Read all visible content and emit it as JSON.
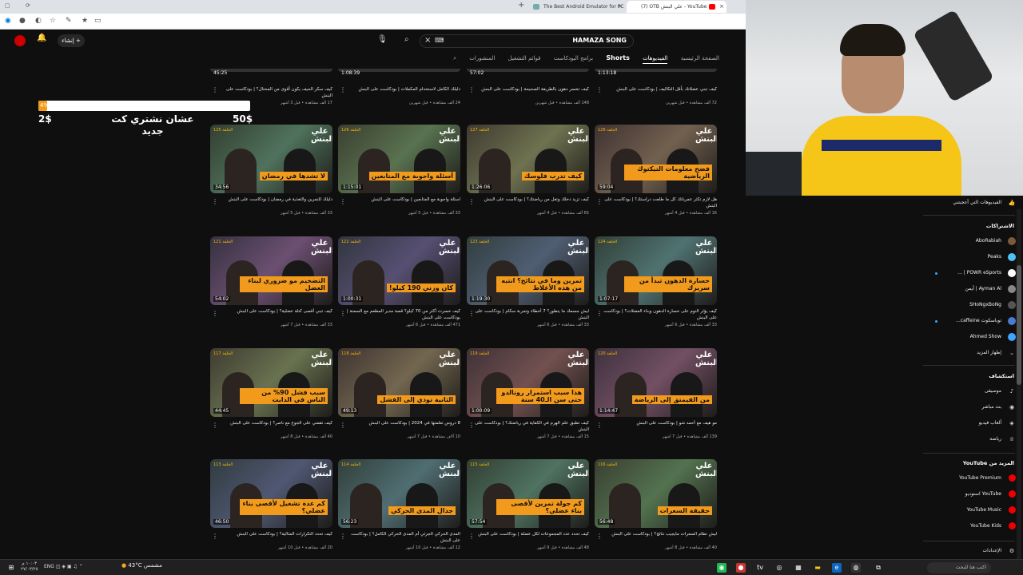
{
  "browser": {
    "tabs": [
      {
        "label": "The Best Android Emulator for PC",
        "active": false
      },
      {
        "label": "(7) OTB علي البنش - YouTube",
        "active": true
      }
    ]
  },
  "youtube": {
    "search_query": "HAMAZA SONG",
    "create_label": "إنشاء",
    "chips": [
      {
        "label": "الصفحة الرئيسية",
        "selected": false
      },
      {
        "label": "الفيديوهات",
        "selected": true
      },
      {
        "label": "Shorts",
        "selected": false
      },
      {
        "label": "برامج البودكاست",
        "selected": false
      },
      {
        "label": "قوائم التشغيل",
        "selected": false
      },
      {
        "label": "المنشورات",
        "selected": false
      }
    ],
    "top_row": [
      {
        "duration": "1:13:18",
        "title": "كيف تبني عضلاتك بأقل التكاليف | بودكاست على البنش",
        "sub": "72 ألف مشاهدة • قبل شهرين"
      },
      {
        "duration": "57:02",
        "title": "كيف تخسر دهون بالطريقة الصحيحة | بودكاست على البنش",
        "sub": "148 ألف مشاهدة • قبل شهرين"
      },
      {
        "duration": "1:08:39",
        "title": "دليلك الكامل لاستخدام المكملات | بودكاست على البنش",
        "sub": "24 ألف مشاهدة • قبل شهرين"
      },
      {
        "duration": "45:25",
        "title": "كيف سكر الحيف يكون أقوى من المحتال؟ | بودكاست على البنش",
        "sub": "17 ألف مشاهدة • قبل 3 أشهر"
      }
    ],
    "videos": [
      {
        "ep": "الحلقة 128",
        "overlay": "فضح معلومات التيكتوك الرياضية",
        "duration": "59:04",
        "title": "هل لازم تكثر عمرياتك كل ما طلعت دراستك؟ | بودكاست على البنش",
        "sub": "16 ألف مشاهدة • قبل 4 أشهر"
      },
      {
        "ep": "الحلقة 127",
        "overlay": "كيف تدرب فلوسك",
        "duration": "1:26:06",
        "title": "كيف تزيد دخلك وتغل من رياضتك؟ | بودكاست على البنش",
        "sub": "65 ألف مشاهدة • قبل 4 أشهر"
      },
      {
        "ep": "الحلقة 126",
        "overlay": "أسئلة واجوبة مع المتابعين",
        "duration": "1:15:01",
        "title": "اسئلة واجوبة مع المتابعين | بودكاست على البنش",
        "sub": "33 ألف مشاهدة • قبل 5 أشهر"
      },
      {
        "ep": "الحلقة 125",
        "overlay": "لا تشدها في رمضان",
        "duration": "34:56",
        "title": "دليلك للتمرين والتغذية في رمضان | بودكاست على البنش",
        "sub": "33 ألف مشاهدة • قبل 5 أشهر"
      },
      {
        "ep": "الحلقة 124",
        "overlay": "خسارة الدهون تبدأ من سريرك",
        "duration": "1:07:17",
        "title": "كيف يؤثر النوم على خسارة الدهون وبناء العضلات؟ | بودكاست على البنش",
        "sub": "33 ألف مشاهدة • قبل 6 أشهر"
      },
      {
        "ep": "الحلقة 123",
        "overlay": "تمرين وما في نتائج؟ انتبه من هذه الأغلاط",
        "duration": "1:19:30",
        "title": "ليش جسمك ما يتطور؟ 7 أخطاء وتجربة سكام | بودكاست على البنش",
        "sub": "33 ألف مشاهدة • قبل 6 أشهر"
      },
      {
        "ep": "الحلقة 122",
        "overlay": "كان وزني 190 كيلو!",
        "duration": "1:00:31",
        "title": "كيف خسرت أكثر من 70 كيلو؟ قصة مدير المطعم مع السمنة | بودكاست على البنش",
        "sub": "471 ألف مشاهدة • قبل 6 أشهر"
      },
      {
        "ep": "الحلقة 121",
        "overlay": "التضخيم مو ضروري لبناء العضل",
        "duration": "54:02",
        "title": "كيف تبني أقصى كتلة عضلية؟ | بودكاست على البنش",
        "sub": "33 ألف مشاهدة • قبل 7 أشهر"
      },
      {
        "ep": "الحلقة 120",
        "overlay": "من الفيمتق إلى الرياضة",
        "duration": "1:14:47",
        "title": "مو هيف مع أحمد شو | بودكاست على البنش",
        "sub": "139 ألف مشاهدة • قبل 7 أشهر"
      },
      {
        "ep": "الحلقة 119",
        "overlay": "هذا سبب استمرار رونالدو حتى سن الـ40 سنة",
        "duration": "1:00:09",
        "title": "كيف تطبق علم الهرم في الكفاية في رياضتك؟ | بودكاست على البنش",
        "sub": "15 ألف مشاهدة • قبل 7 أشهر"
      },
      {
        "ep": "الحلقة 118",
        "overlay": "الثانية تودي إلى الفشل",
        "duration": "49:13",
        "title": "8 دروس تعلمتها في 2024 | بودكاست على البنش",
        "sub": "10 آلاف مشاهدة • قبل 7 أشهر"
      },
      {
        "ep": "الحلقة 117",
        "overlay": "سبب فشل 90% من الناس في الدايت",
        "duration": "44:45",
        "title": "كيف تقضي على الجوع مع ناصر؟ | بودكاست على البنش",
        "sub": "40 ألف مشاهدة • قبل 8 أشهر"
      },
      {
        "ep": "الحلقة 116",
        "overlay": "حقيقة السعرات",
        "duration": "56:48",
        "title": "ليش نظام السعرات مايجيب نتائج؟ | بودكاست على البنش",
        "sub": "40 ألف مشاهدة • قبل 8 أشهر"
      },
      {
        "ep": "الحلقة 115",
        "overlay": "كم جولة تمرين لأقصى بناء عضلي؟",
        "duration": "57:54",
        "title": "كيف تحدد عدد المجموعات لكل عضلة | بودكاست على البنش",
        "sub": "48 ألف مشاهدة • قبل 9 أشهر"
      },
      {
        "ep": "الحلقة 114",
        "overlay": "جدال المدى الحركي",
        "duration": "56:23",
        "title": "المدى الحركي الجزئي أم المدى الحركي الكامل؟ | بودكاست على البنش",
        "sub": "12 ألف مشاهدة • قبل 10 أشهر"
      },
      {
        "ep": "الحلقة 113",
        "overlay": "كم عدة تشغيل لأقصى بناء عضلي؟",
        "duration": "46:50",
        "title": "كيف تحدد التكرارات المثالية؟ | بودكاست على البنش",
        "sub": "20 ألف مشاهدة • قبل 10 أشهر"
      }
    ],
    "brand_text": "علي البنش"
  },
  "donation_overlay": {
    "progress_label": "4%",
    "progress_fraction": 0.04,
    "min_amount": "2$",
    "goal_amount": "50$",
    "goal_text": "عشان نشتري كت جديد"
  },
  "sidebar": {
    "liked": "الفيديوهات التي أعجبتني",
    "subs_heading": "الاشتراكات",
    "subscriptions": [
      {
        "name": "AboRabiah",
        "dot": false,
        "color": "#7a5a3a"
      },
      {
        "name": "Peaks",
        "dot": false,
        "color": "#4fc3f7"
      },
      {
        "name": "POWR eSports | ...",
        "dot": true,
        "color": "#ffffff"
      },
      {
        "name": "Ayman Al | أيمن",
        "dot": false,
        "color": "#888888"
      },
      {
        "name": "SHoNgxBoNg",
        "dot": false,
        "color": "#555555"
      },
      {
        "name": "توباسكوت caffeine...",
        "dot": true,
        "color": "#4a7bd1"
      },
      {
        "name": "Ahmed Show",
        "dot": false,
        "color": "#3ea6ff"
      }
    ],
    "show_more": "إظهار المزيد",
    "explore_heading": "استكشاف",
    "explore": [
      {
        "name": "موسيقى",
        "icon": "♪"
      },
      {
        "name": "بث مباشر",
        "icon": "◉"
      },
      {
        "name": "ألعاب فيديو",
        "icon": "◈"
      },
      {
        "name": "رياضة",
        "icon": "♕"
      }
    ],
    "more_heading": "المزيد من YouTube",
    "more": [
      {
        "name": "YouTube Premium"
      },
      {
        "name": "YouTube استوديو"
      },
      {
        "name": "YouTube Music"
      },
      {
        "name": "YouTube Kids"
      }
    ],
    "settings": "الإعدادات"
  },
  "taskbar": {
    "weather": "43°C مشمس",
    "search": "اكتب هنا للبحث",
    "lang": "ENG",
    "clock_time": "١٠:٠٣ م",
    "clock_date": "٢٧/٠٣/٢٥"
  }
}
